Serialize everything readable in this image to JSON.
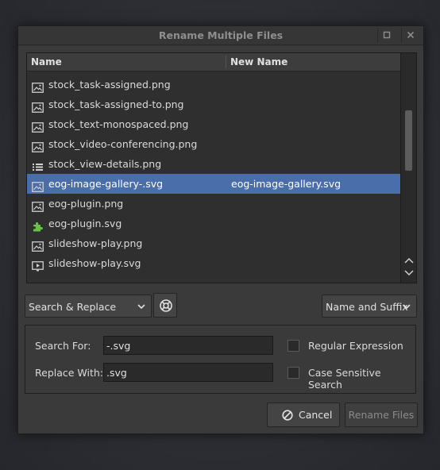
{
  "window": {
    "title": "Rename Multiple Files",
    "maximize_icon": "maximize-icon",
    "close_icon": "close-icon"
  },
  "list": {
    "columns": [
      "Name",
      "New Name"
    ],
    "rows": [
      {
        "name": "stock_task-assigned.png",
        "new_name": "",
        "icon": "image-file-icon",
        "selected": false
      },
      {
        "name": "stock_task-assigned-to.png",
        "new_name": "",
        "icon": "image-file-icon",
        "selected": false
      },
      {
        "name": "stock_text-monospaced.png",
        "new_name": "",
        "icon": "image-file-icon",
        "selected": false
      },
      {
        "name": "stock_video-conferencing.png",
        "new_name": "",
        "icon": "image-file-icon",
        "selected": false
      },
      {
        "name": "stock_view-details.png",
        "new_name": "",
        "icon": "list-view-icon",
        "selected": false
      },
      {
        "name": "eog-image-gallery-.svg",
        "new_name": "eog-image-gallery.svg",
        "icon": "image-file-icon",
        "selected": true
      },
      {
        "name": "eog-plugin.png",
        "new_name": "",
        "icon": "image-file-icon",
        "selected": false
      },
      {
        "name": "eog-plugin.svg",
        "new_name": "",
        "icon": "puzzle-piece-icon",
        "selected": false
      },
      {
        "name": "slideshow-play.png",
        "new_name": "",
        "icon": "image-file-icon",
        "selected": false
      },
      {
        "name": "slideshow-play.svg",
        "new_name": "",
        "icon": "slideshow-icon",
        "selected": false
      }
    ]
  },
  "controls": {
    "mode_select": "Search & Replace",
    "help_icon": "lifebuoy-icon",
    "rename_target_select": "Name and Suffix"
  },
  "form": {
    "search_label": "Search For:",
    "search_value": "-.svg",
    "replace_label": "Replace With:",
    "replace_value": ".svg",
    "regex_label": "Regular Expression",
    "regex_checked": false,
    "case_label": "Case Sensitive Search",
    "case_checked": false
  },
  "buttons": {
    "cancel": "Cancel",
    "cancel_icon": "cancel-icon",
    "rename": "Rename Files",
    "rename_enabled": false
  }
}
